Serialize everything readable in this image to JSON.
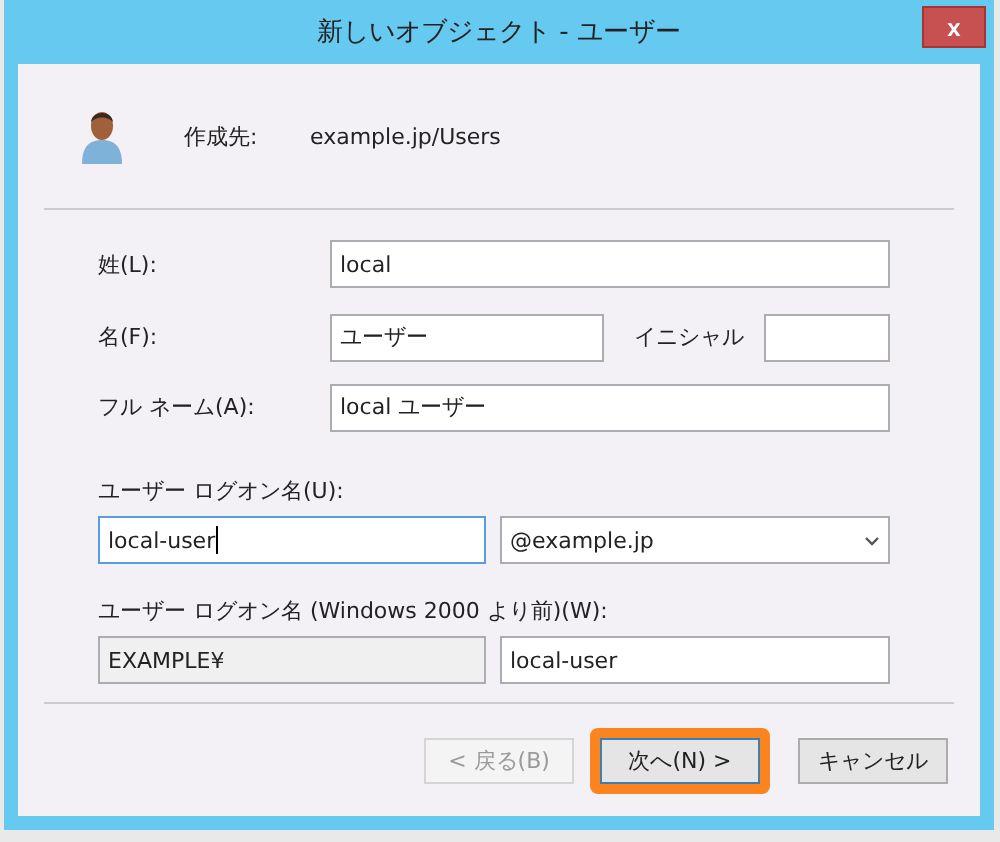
{
  "window": {
    "title": "新しいオブジェクト - ユーザー",
    "close": "x"
  },
  "header": {
    "label": "作成先:",
    "value": "example.jp/Users"
  },
  "fields": {
    "last_name": {
      "label": "姓(L):",
      "value": "local"
    },
    "first_name": {
      "label": "名(F):",
      "value": "ユーザー"
    },
    "initials": {
      "label": "イニシャル"
    },
    "full_name": {
      "label": "フル ネーム(A):",
      "value": "local ユーザー"
    },
    "logon_name": {
      "label": "ユーザー ログオン名(U):",
      "value": "local-user",
      "focused": true,
      "domain": "@example.jp"
    },
    "logon_name_pre2000": {
      "label": "ユーザー ログオン名 (Windows 2000 より前)(W):",
      "domain": "EXAMPLE¥",
      "value": "local-user"
    }
  },
  "buttons": [
    {
      "label": "< 戻る(B)",
      "disabled": true,
      "focused": false,
      "highlighted": false
    },
    {
      "label": "次へ(N) >",
      "disabled": false,
      "focused": true,
      "highlighted": true
    },
    {
      "label": "キャンセル",
      "disabled": false,
      "focused": false,
      "highlighted": false
    }
  ]
}
